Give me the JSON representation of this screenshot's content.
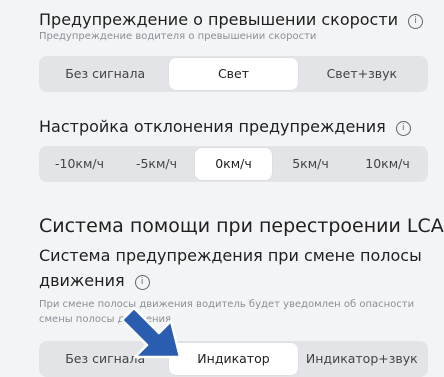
{
  "speed_warning": {
    "title": "Предупреждение о превышении скорости",
    "subtitle": "Предупреждение водителя о превышении скорости",
    "options": [
      "Без сигнала",
      "Свет",
      "Свет+звук"
    ],
    "selected": "Свет"
  },
  "deviation": {
    "title": "Настройка отклонения предупреждения",
    "options": [
      "-10км/ч",
      "-5км/ч",
      "0км/ч",
      "5км/ч",
      "10км/ч"
    ],
    "selected": "0км/ч"
  },
  "lca": {
    "section_title": "Система помощи при перестроении LCA",
    "title_line1": "Система предупреждения при смене полосы",
    "title_line2": "движения",
    "desc_line1": "При смене полосы движения водитель будет уведомлен об опасности",
    "desc_line2": "смены полосы движения",
    "options": [
      "Без сигнала",
      "Индикатор",
      "Индикатор+звук"
    ],
    "selected": "Индикатор"
  },
  "colors": {
    "arrow": "#2a5db0",
    "accent_bg": "#ffffff",
    "segment_bg": "#e2e4e8"
  },
  "icons": {
    "info": "info-icon",
    "pointer": "pointer-arrow-icon"
  },
  "info_glyph": "i"
}
